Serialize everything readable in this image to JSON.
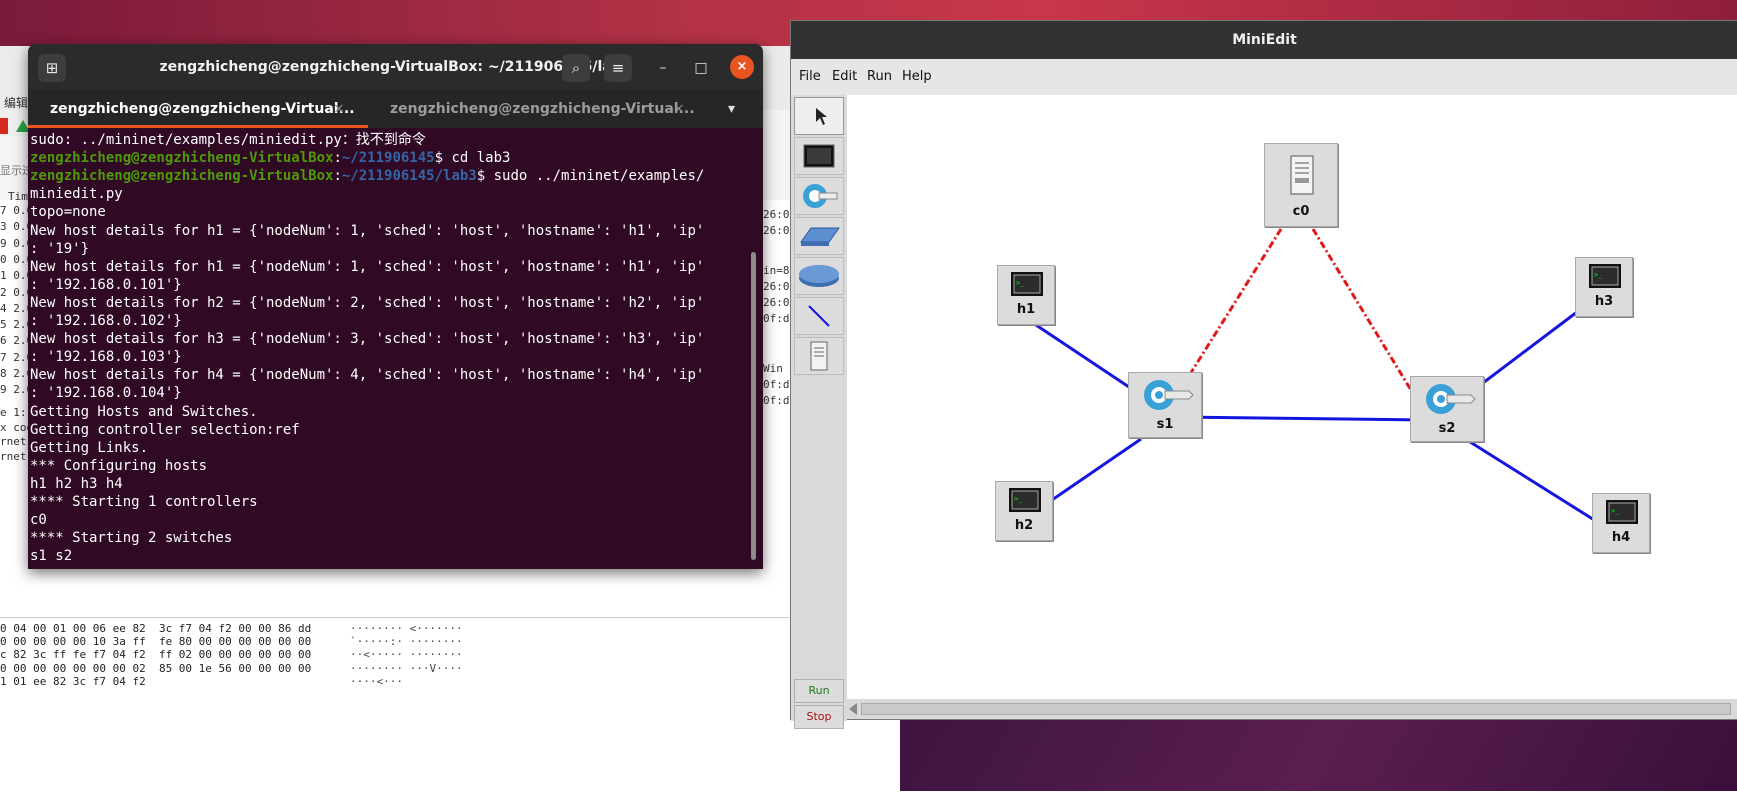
{
  "colors": {
    "terminal_bg": "#300a24",
    "prompt_user": "#4e9a06",
    "prompt_path": "#3465a4",
    "accent": "#e9541f",
    "link_blue": "#1515e0",
    "controller_link_red": "#e01818"
  },
  "terminal": {
    "title": "zengzhicheng@zengzhicheng-VirtualBox: ~/211906145/lab3",
    "tabs": [
      {
        "label": "zengzhicheng@zengzhicheng-Virtual...",
        "close": "×"
      },
      {
        "label": "zengzhicheng@zengzhicheng-Virtual...",
        "close": "×"
      }
    ],
    "tab_menu": "▾",
    "controls": {
      "new_tab": "⊞",
      "search": "⌕",
      "menu": "≡",
      "minimize": "–",
      "maximize": "□",
      "close": "×"
    },
    "lines": [
      "sudo: ../mininet/examples/miniedit.py：找不到命令",
      {
        "user": "zengzhicheng@zengzhicheng-VirtualBox",
        "path": "~/211906145",
        "cmd": "$ cd lab3"
      },
      {
        "user": "zengzhicheng@zengzhicheng-VirtualBox",
        "path": "~/211906145/lab3",
        "cmd": "$ sudo ../mininet/examples/"
      },
      "miniedit.py",
      "topo=none",
      "New host details for h1 = {'nodeNum': 1, 'sched': 'host', 'hostname': 'h1', 'ip'",
      ": '19'}",
      "New host details for h1 = {'nodeNum': 1, 'sched': 'host', 'hostname': 'h1', 'ip'",
      ": '192.168.0.101'}",
      "New host details for h2 = {'nodeNum': 2, 'sched': 'host', 'hostname': 'h2', 'ip'",
      ": '192.168.0.102'}",
      "New host details for h3 = {'nodeNum': 3, 'sched': 'host', 'hostname': 'h3', 'ip'",
      ": '192.168.0.103'}",
      "New host details for h4 = {'nodeNum': 4, 'sched': 'host', 'hostname': 'h4', 'ip'",
      ": '192.168.0.104'}",
      "Getting Hosts and Switches.",
      "Getting controller selection:ref",
      "Getting Links.",
      "*** Configuring hosts",
      "h1 h2 h3 h4",
      "**** Starting 1 controllers",
      "c0",
      "**** Starting 2 switches",
      "s1 s2"
    ]
  },
  "miniedit": {
    "title": "MiniEdit",
    "menus": [
      "File",
      "Edit",
      "Run",
      "Help"
    ],
    "tools": [
      "select",
      "host",
      "switch",
      "legacy-switch",
      "legacy-router",
      "netlink",
      "controller"
    ],
    "run_label": "Run",
    "stop_label": "Stop",
    "nodes": [
      {
        "id": "c0",
        "kind": "controller"
      },
      {
        "id": "h1",
        "kind": "host"
      },
      {
        "id": "h2",
        "kind": "host"
      },
      {
        "id": "h3",
        "kind": "host"
      },
      {
        "id": "h4",
        "kind": "host"
      },
      {
        "id": "s1",
        "kind": "switch"
      },
      {
        "id": "s2",
        "kind": "switch"
      }
    ],
    "links": [
      [
        "h1",
        "s1"
      ],
      [
        "h2",
        "s1"
      ],
      [
        "s1",
        "s2"
      ],
      [
        "s2",
        "h3"
      ],
      [
        "s2",
        "h4"
      ]
    ],
    "controller_links": [
      [
        "c0",
        "s1"
      ],
      [
        "c0",
        "s2"
      ]
    ]
  },
  "wireshark": {
    "menu_fragment": "编辑",
    "filter_fragment": "显示过",
    "col_fragment": "Tim",
    "row_prefixes": [
      "7 0.0",
      "3 0.0",
      "9 0.0",
      "0 0.0",
      "1 0.0",
      "2 0.0",
      "4 2.0",
      "5 2.0",
      "6 2.0",
      "7 2.0",
      "8 2.0",
      "9 2.0"
    ],
    "right_frags": [
      "26:0",
      "26:0",
      "in=8",
      "26:0",
      "26:0",
      "0f:d",
      "Win",
      "0f:d",
      "0f:d"
    ],
    "detail_frags": [
      "e 1:",
      "x coo",
      "rnet",
      "rnet"
    ],
    "hex_lines": [
      {
        "hex": "0 04 00 01 00 06 ee 82  3c f7 04 f2 00 00 86 dd",
        "ascii": "········ <·······"
      },
      {
        "hex": "0 00 00 00 00 10 3a ff  fe 80 00 00 00 00 00 00",
        "ascii": "`·····:· ········"
      },
      {
        "hex": "c 82 3c ff fe f7 04 f2  ff 02 00 00 00 00 00 00",
        "ascii": "··<····· ········"
      },
      {
        "hex": "0 00 00 00 00 00 00 02  85 00 1e 56 00 00 00 00",
        "ascii": "········ ···V····"
      },
      {
        "hex": "1 01 ee 82 3c f7 04 f2",
        "ascii": "····<···"
      }
    ]
  }
}
